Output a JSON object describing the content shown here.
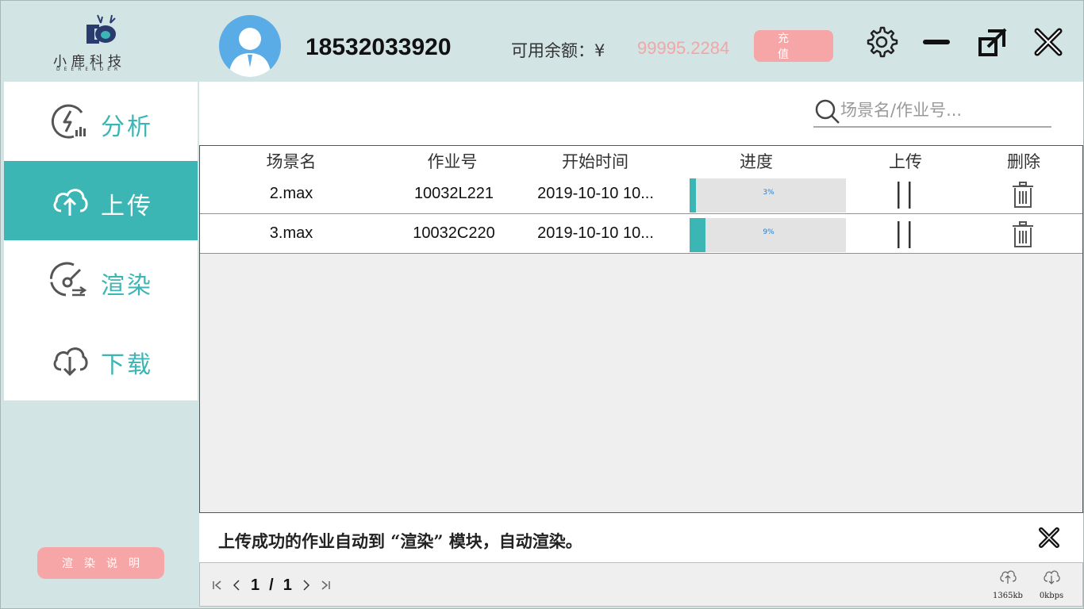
{
  "brand": {
    "name_cn": "小鹿科技",
    "name_en": "DEERENDER"
  },
  "user": {
    "phone": "18532033920"
  },
  "account": {
    "balance_label": "可用余额：¥",
    "balance_value": "99995.2284",
    "recharge_label": "充 值"
  },
  "sidebar": {
    "items": [
      {
        "label": "分析",
        "icon": "analysis-icon",
        "active": false
      },
      {
        "label": "上传",
        "icon": "upload-cloud-icon",
        "active": true
      },
      {
        "label": "渲染",
        "icon": "render-gauge-icon",
        "active": false
      },
      {
        "label": "下载",
        "icon": "download-cloud-icon",
        "active": false
      }
    ],
    "explain_label": "渲染说明"
  },
  "search": {
    "placeholder": "场景名/作业号..."
  },
  "table": {
    "columns": [
      "场景名",
      "作业号",
      "开始时间",
      "进度",
      "上传",
      "删除"
    ],
    "rows": [
      {
        "scene": "2.max",
        "job": "10032L221",
        "start": "2019-10-10 10...",
        "progress": 3,
        "progress_label": "3%"
      },
      {
        "scene": "3.max",
        "job": "10032C220",
        "start": "2019-10-10 10...",
        "progress": 9,
        "progress_label": "9%"
      }
    ]
  },
  "notice": {
    "text": "上传成功的作业自动到 “渲染” 模块，自动渲染。"
  },
  "pager": {
    "current": "1",
    "separator": "/",
    "total": "1"
  },
  "status": {
    "upload_speed": "1365kb",
    "download_speed": "0kbps"
  },
  "colors": {
    "accent": "#3bb6b5",
    "pink": "#f6a6a6",
    "avatar": "#5aace6",
    "bg": "#d3e4e5"
  }
}
